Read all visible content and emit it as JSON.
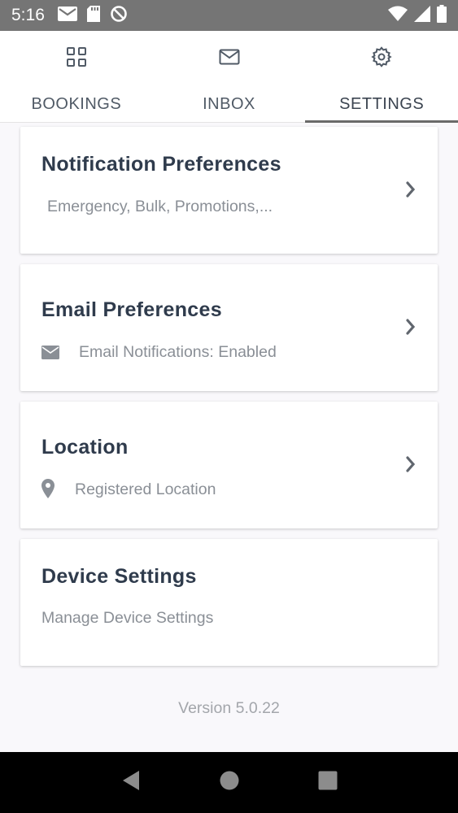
{
  "status_bar": {
    "time": "5:16",
    "icons": [
      "gmail-icon",
      "sd-card-icon",
      "data-saver-icon",
      "wifi-icon",
      "signal-icon",
      "battery-icon"
    ]
  },
  "tabs": [
    {
      "label": "BOOKINGS",
      "icon": "grid-icon",
      "active": false
    },
    {
      "label": "INBOX",
      "icon": "envelope-icon",
      "active": false
    },
    {
      "label": "SETTINGS",
      "icon": "gear-icon",
      "active": true
    }
  ],
  "cards": {
    "notification": {
      "title": "Notification Preferences",
      "subtitle": "Emergency, Bulk, Promotions,..."
    },
    "email": {
      "title": "Email Preferences",
      "subtitle": "Email Notifications: Enabled",
      "icon": "envelope-icon"
    },
    "location": {
      "title": "Location",
      "subtitle": "Registered Location",
      "icon": "map-pin-icon"
    },
    "device": {
      "title": "Device Settings",
      "subtitle": "Manage Device Settings"
    }
  },
  "version": "Version 5.0.22",
  "colors": {
    "title": "#2f3b4c",
    "subtitle": "#8a8f96",
    "background": "#f9f8fb",
    "status_bar": "#757575"
  }
}
